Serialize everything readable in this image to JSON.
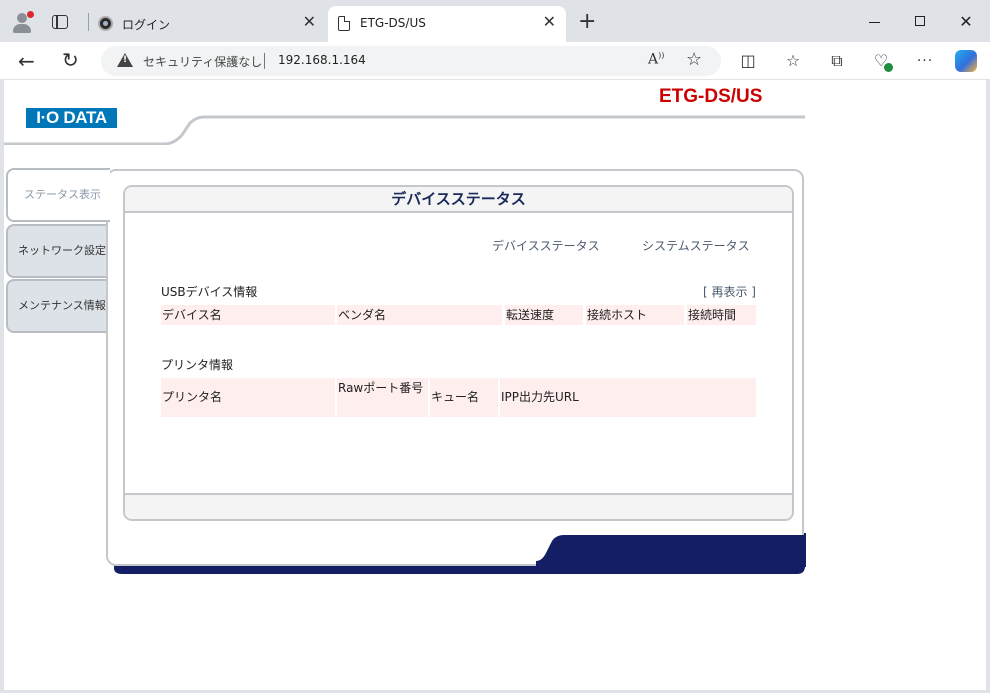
{
  "browser": {
    "tabs": [
      {
        "title": "ログイン",
        "active": false
      },
      {
        "title": "ETG-DS/US",
        "active": true
      }
    ],
    "address": {
      "security_label": "セキュリティ保護なし",
      "url": "192.168.1.164"
    }
  },
  "page": {
    "logo_text": "I·O DATA",
    "product_title": "ETG-DS/US",
    "side_menu": [
      {
        "label": "ステータス表示",
        "active": true
      },
      {
        "label": "ネットワーク設定",
        "active": false
      },
      {
        "label": "メンテナンス情報",
        "active": false
      }
    ],
    "panel_title": "デバイスステータス",
    "sub_nav": {
      "device_status": "デバイスステータス",
      "system_status": "システムステータス"
    },
    "usb_section": {
      "title": "USBデバイス情報",
      "refresh_label": "[ 再表示 ]",
      "columns": [
        "デバイス名",
        "ベンダ名",
        "転送速度",
        "接続ホスト",
        "接続時間"
      ]
    },
    "printer_section": {
      "title": "プリンタ情報",
      "columns": [
        "プリンタ名",
        "Rawポート番号",
        "キュー名",
        "IPP出力先URL"
      ]
    }
  },
  "colors": {
    "product_title": "#cc0000",
    "logo_bg": "#0077b8",
    "navy_accent": "#141e64",
    "table_header_bg": "#ffeeee"
  }
}
